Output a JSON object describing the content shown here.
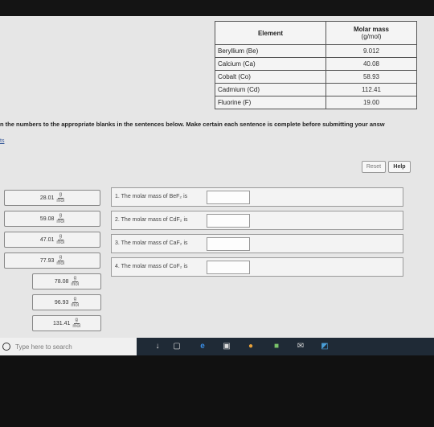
{
  "table": {
    "header_element": "Element",
    "header_molar_mass": "Molar mass",
    "header_unit": "(g/mol)",
    "rows": [
      {
        "element": "Beryllium (Be)",
        "mass": "9.012"
      },
      {
        "element": "Calcium (Ca)",
        "mass": "40.08"
      },
      {
        "element": "Cobalt (Co)",
        "mass": "58.93"
      },
      {
        "element": "Cadmium (Cd)",
        "mass": "112.41"
      },
      {
        "element": "Fluorine (F)",
        "mass": "19.00"
      }
    ]
  },
  "instructions": "n the numbers to the appropriate blanks in the sentences below. Make certain each sentence is complete before submitting your answ",
  "tab_link": "ts",
  "buttons": {
    "reset": "Reset",
    "help": "Help"
  },
  "unit": {
    "num": "g",
    "den": "mol"
  },
  "tiles": [
    "28.01",
    "59.08",
    "47.01",
    "77.93",
    "78.08",
    "96.93",
    "131.41"
  ],
  "sentences": [
    "1. The molar mass of BeF₂ is",
    "2. The molar mass of CdF₂ is",
    "3. The molar mass of CaF₂ is",
    "4. The molar mass of CoF₂ is"
  ],
  "taskbar": {
    "search_placeholder": "Type here to search"
  }
}
